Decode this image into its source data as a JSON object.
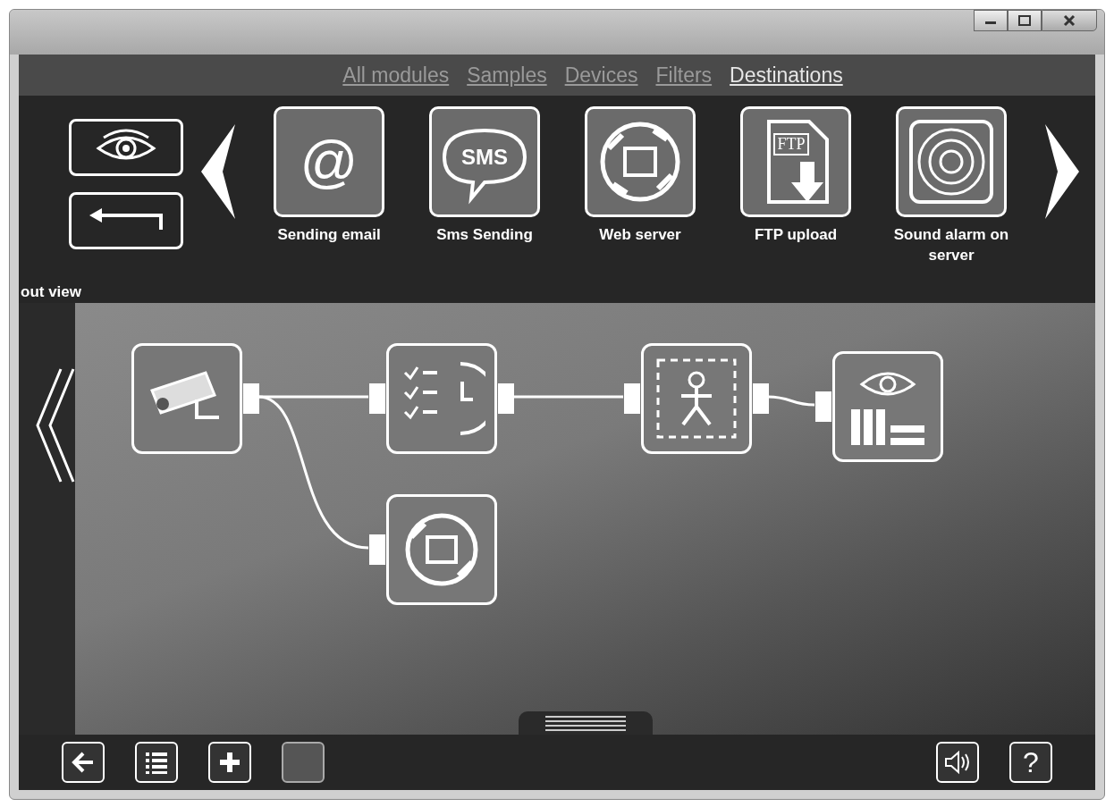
{
  "tabs": [
    {
      "label": "All modules",
      "selected": false
    },
    {
      "label": "Samples",
      "selected": false
    },
    {
      "label": "Devices",
      "selected": false
    },
    {
      "label": "Filters",
      "selected": false
    },
    {
      "label": "Destinations",
      "selected": true
    }
  ],
  "modules": [
    {
      "label": "Sending email",
      "kind": "email",
      "glyph": "@"
    },
    {
      "label": "Sms Sending",
      "kind": "sms",
      "glyph": "SMS"
    },
    {
      "label": "Web server",
      "kind": "web"
    },
    {
      "label": "FTP upload",
      "kind": "ftp",
      "glyph": "FTP"
    },
    {
      "label": "Sound alarm on server",
      "kind": "sound"
    }
  ],
  "view_label": "out view",
  "nodes": [
    {
      "kind": "camera"
    },
    {
      "kind": "schedule"
    },
    {
      "kind": "motion"
    },
    {
      "kind": "archive"
    },
    {
      "kind": "web"
    }
  ],
  "toolbar": {
    "help": "?"
  }
}
